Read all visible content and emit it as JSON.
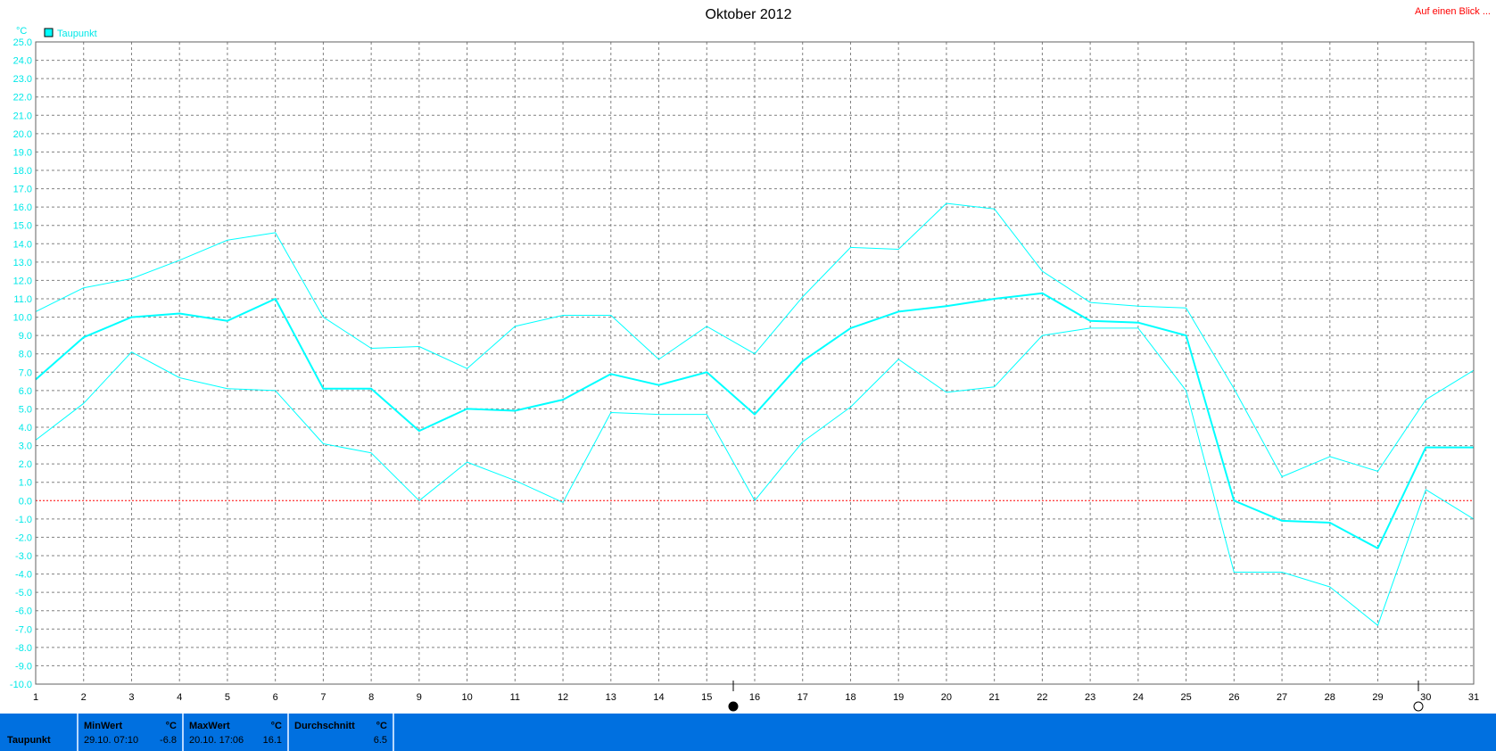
{
  "header": {
    "title": "Oktober 2012",
    "link_label": "Auf einen Blick ..."
  },
  "legend": {
    "label": "Taupunkt",
    "color": "#00ffff"
  },
  "unit_label": "°C",
  "colors": {
    "series": "#00ffff",
    "axis_text": "#00e8e8",
    "zero_line": "#ff0000",
    "footer": "#0070e0"
  },
  "chart_data": {
    "type": "line",
    "title": "Oktober 2012",
    "ylabel": "°C",
    "ylim": [
      -10,
      25
    ],
    "xlim": [
      1,
      31
    ],
    "grid": true,
    "legend_position": "top-left",
    "x": [
      1,
      2,
      3,
      4,
      5,
      6,
      7,
      8,
      9,
      10,
      11,
      12,
      13,
      14,
      15,
      16,
      17,
      18,
      19,
      20,
      21,
      22,
      23,
      24,
      25,
      26,
      27,
      28,
      29,
      30,
      31
    ],
    "yticks": [
      "25.0",
      "24.0",
      "23.0",
      "22.0",
      "21.0",
      "20.0",
      "19.0",
      "18.0",
      "17.0",
      "16.0",
      "15.0",
      "14.0",
      "13.0",
      "12.0",
      "11.0",
      "10.0",
      "9.0",
      "8.0",
      "7.0",
      "6.0",
      "5.0",
      "4.0",
      "3.0",
      "2.0",
      "1.0",
      "0.0",
      "-1.0",
      "-2.0",
      "-3.0",
      "-4.0",
      "-5.0",
      "-6.0",
      "-7.0",
      "-8.0",
      "-9.0",
      "-10.0"
    ],
    "series": [
      {
        "name": "Taupunkt",
        "role": "mean",
        "values": [
          6.6,
          8.9,
          10.0,
          10.2,
          9.8,
          11.0,
          6.1,
          6.1,
          3.8,
          5.0,
          4.9,
          5.5,
          6.9,
          6.3,
          7.0,
          4.7,
          7.6,
          9.4,
          10.3,
          10.6,
          11.0,
          11.3,
          9.8,
          9.7,
          9.0,
          0.0,
          -1.1,
          -1.2,
          -2.6,
          2.9,
          2.9
        ]
      },
      {
        "role": "max",
        "values": [
          10.3,
          11.6,
          12.1,
          13.1,
          14.2,
          14.6,
          10.0,
          8.3,
          8.4,
          7.2,
          9.5,
          10.1,
          10.1,
          7.7,
          9.5,
          8.0,
          11.1,
          13.8,
          13.7,
          16.2,
          15.9,
          12.5,
          10.8,
          10.6,
          10.5,
          6.1,
          1.3,
          2.4,
          1.6,
          5.5,
          7.1
        ]
      },
      {
        "role": "min",
        "values": [
          3.3,
          5.3,
          8.1,
          6.7,
          6.1,
          6.0,
          3.1,
          2.6,
          0.0,
          2.1,
          1.1,
          -0.1,
          4.8,
          4.7,
          4.7,
          0.0,
          3.2,
          5.1,
          7.7,
          5.9,
          6.2,
          9.0,
          9.4,
          9.4,
          6.0,
          -3.9,
          -3.9,
          -4.7,
          -6.8,
          0.6,
          -1.0
        ]
      }
    ]
  },
  "stats": {
    "row_label": "Taupunkt",
    "min": {
      "header": "MinWert",
      "unit": "°C",
      "time": "29.10.  07:10",
      "value": "-6.8"
    },
    "max": {
      "header": "MaxWert",
      "unit": "°C",
      "time": "20.10.  17:06",
      "value": "16.1"
    },
    "avg": {
      "header": "Durchschnitt",
      "unit": "°C",
      "value": "6.5"
    }
  }
}
